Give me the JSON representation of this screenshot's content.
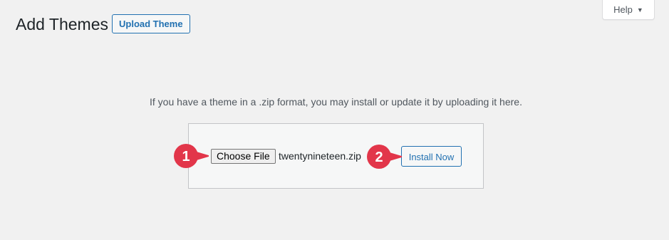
{
  "help_tab": {
    "label": "Help",
    "caret_icon": "triangle-down-icon",
    "caret": "▼"
  },
  "header": {
    "title": "Add Themes",
    "upload_button_label": "Upload Theme"
  },
  "upload": {
    "instructions": "If you have a theme in a .zip format, you may install or update it by uploading it here.",
    "choose_file_label": "Choose File",
    "file_name": "twentynineteen.zip",
    "install_button_label": "Install Now"
  },
  "step_markers": [
    {
      "number": "1"
    },
    {
      "number": "2"
    }
  ],
  "colors": {
    "background": "#f1f1f1",
    "accent": "#2271b1",
    "marker_red": "#e2364a"
  }
}
